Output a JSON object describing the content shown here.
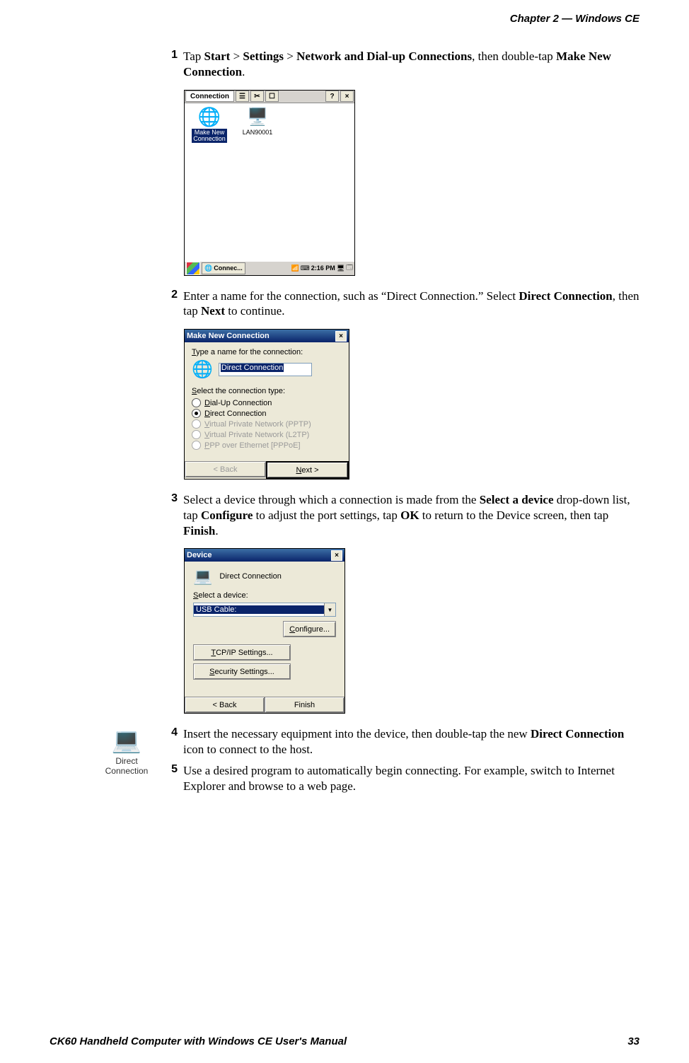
{
  "page": {
    "running_head": "Chapter 2 —  Windows CE",
    "footer_left": "CK60 Handheld Computer with Windows CE User's Manual",
    "footer_page": "33"
  },
  "steps": {
    "s1_num": "1",
    "s1_a": "Tap ",
    "s1_b": "Start",
    "s1_c": " > ",
    "s1_d": "Settings",
    "s1_e": " > ",
    "s1_f": "Network and Dial-up Connections",
    "s1_g": ", then double-tap ",
    "s1_h": "Make New Connection",
    "s1_i": ".",
    "s2_num": "2",
    "s2_a": "Enter a name for the connection, such as “Direct Connection.” Select ",
    "s2_b": "Direct Connection",
    "s2_c": ", then tap ",
    "s2_d": "Next",
    "s2_e": " to continue.",
    "s3_num": "3",
    "s3_a": "Select a device through which a connection is made from the ",
    "s3_b": "Select a device",
    "s3_c": " drop-down list, tap ",
    "s3_d": "Configure",
    "s3_e": " to adjust the port settings, tap ",
    "s3_f": "OK",
    "s3_g": " to return to the Device screen, then tap ",
    "s3_h": "Finish",
    "s3_i": ".",
    "s4_num": "4",
    "s4_a": "Insert the necessary equipment into the device, then double-tap the new ",
    "s4_b": "Direct Connection",
    "s4_c": " icon to connect to the host.",
    "s5_num": "5",
    "s5_a": "Use a desired program to automatically begin connecting. For example, switch to Internet Explorer and browse to a web page."
  },
  "ss1": {
    "title": "Connection",
    "help": "?",
    "close": "×",
    "icon1_label_l1": "Make New",
    "icon1_label_l2": "Connection",
    "icon2_label": "LAN90001",
    "task_label": "Connec...",
    "time": "2:16 PM"
  },
  "ss2": {
    "title": "Make New Connection",
    "close": "×",
    "name_label_pre": "T",
    "name_label_post": "ype a name for the connection:",
    "name_value": "Direct Connection",
    "type_label_pre": "S",
    "type_label_post": "elect the connection type:",
    "r1_pre": "D",
    "r1_post": "ial-Up Connection",
    "r2_pre": "D",
    "r2_post": "irect Connection",
    "r3_pre": "V",
    "r3_post": "irtual Private Network (PPTP)",
    "r4_pre": "V",
    "r4_post": "irtual Private Network (L2TP)",
    "r5_pre": "P",
    "r5_post": "PP over Ethernet [PPPoE]",
    "back": "< Back",
    "next_pre": "N",
    "next_post": "ext >"
  },
  "ss3": {
    "title": "Device",
    "close": "×",
    "heading": "Direct Connection",
    "select_label_pre": "S",
    "select_label_post": "elect a device:",
    "select_value": "USB Cable:",
    "configure_pre": "C",
    "configure_post": "onfigure...",
    "tcp_pre": "T",
    "tcp_post": "CP/IP Settings...",
    "sec_pre": "S",
    "sec_post": "ecurity Settings...",
    "back": "< Back",
    "finish": "Finish"
  },
  "margin_icon": {
    "label_l1": "Direct",
    "label_l2": "Connection"
  }
}
